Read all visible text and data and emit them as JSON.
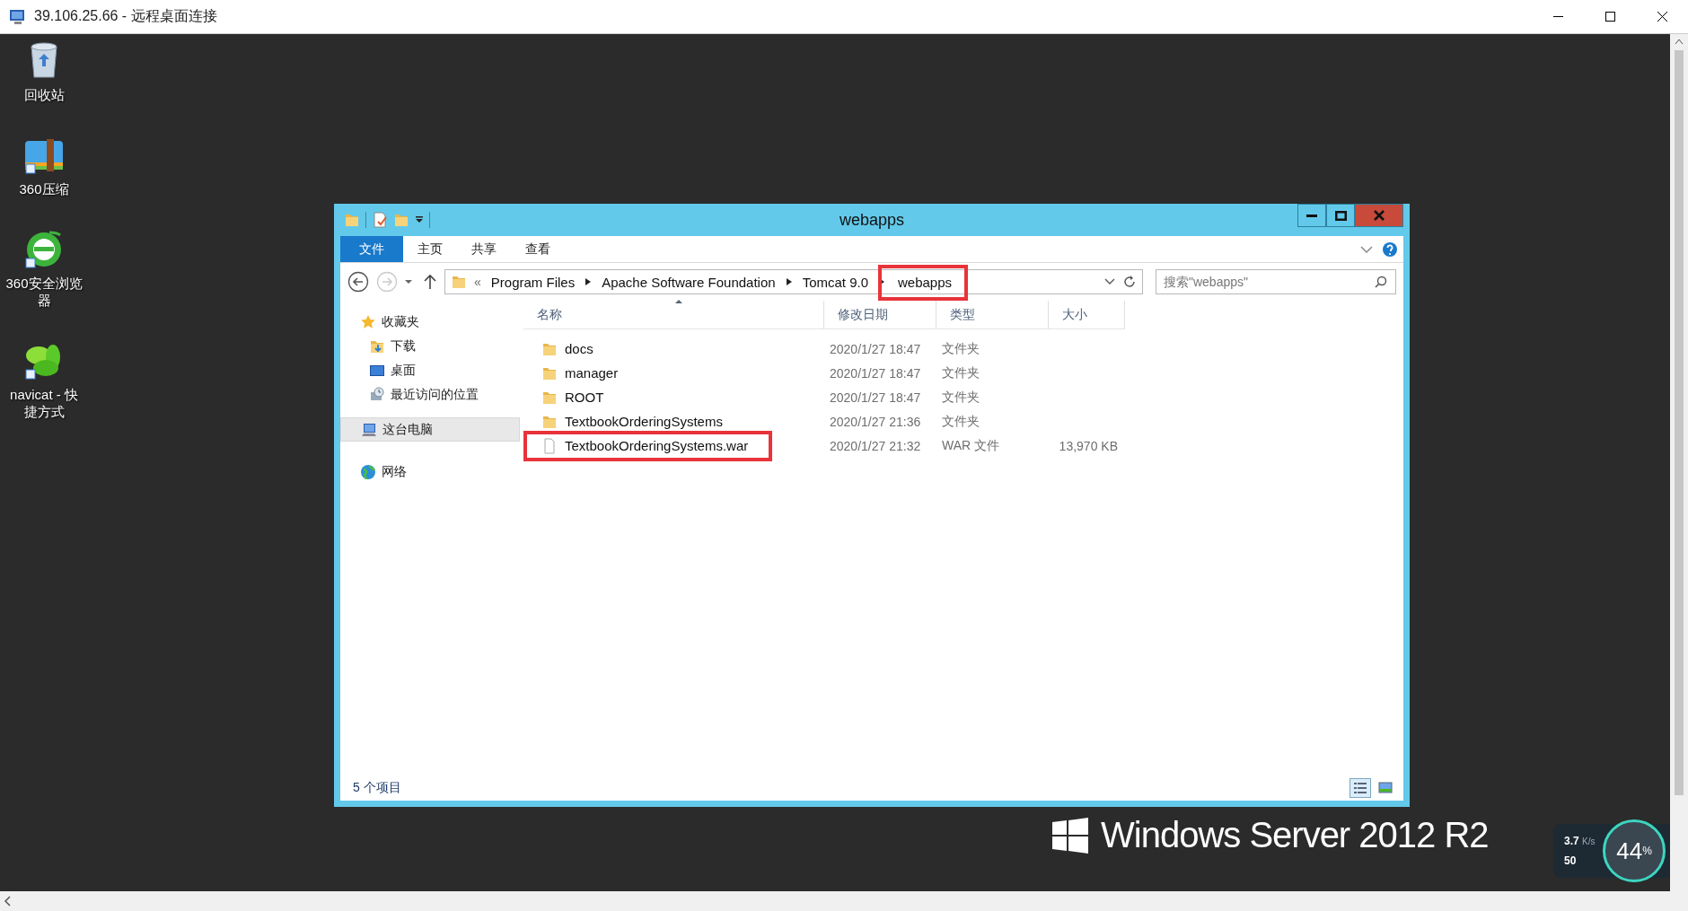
{
  "rdp_window": {
    "title": "39.106.25.66 - 远程桌面连接"
  },
  "desktop_icons": [
    {
      "label": "回收站",
      "kind": "recycle"
    },
    {
      "label": "360压缩",
      "kind": "zip"
    },
    {
      "label": "360安全浏览器",
      "kind": "browser"
    },
    {
      "label": "navicat - 快捷方式",
      "kind": "navicat"
    }
  ],
  "explorer": {
    "title": "webapps",
    "ribbon_tabs": [
      {
        "label": "文件",
        "selected": true
      },
      {
        "label": "主页",
        "selected": false
      },
      {
        "label": "共享",
        "selected": false
      },
      {
        "label": "查看",
        "selected": false
      }
    ],
    "overflow_marker": "«",
    "breadcrumb": [
      {
        "label": "Program Files",
        "highlighted": false
      },
      {
        "label": "Apache Software Foundation",
        "highlighted": false
      },
      {
        "label": "Tomcat 9.0",
        "highlighted": false
      },
      {
        "label": "webapps",
        "highlighted": true
      }
    ],
    "search": {
      "placeholder": "搜索\"webapps\""
    },
    "nav_pane": [
      {
        "label": "收藏夹",
        "kind": "favorites",
        "selected": false,
        "children": [
          {
            "label": "下载",
            "kind": "downloads",
            "selected": false
          },
          {
            "label": "桌面",
            "kind": "desktop",
            "selected": false
          },
          {
            "label": "最近访问的位置",
            "kind": "recent",
            "selected": false
          }
        ]
      },
      {
        "label": "这台电脑",
        "kind": "pc",
        "selected": true
      },
      {
        "label": "网络",
        "kind": "network",
        "selected": false
      }
    ],
    "columns": [
      {
        "label": "名称",
        "sorted": true
      },
      {
        "label": "修改日期",
        "sorted": false
      },
      {
        "label": "类型",
        "sorted": false
      },
      {
        "label": "大小",
        "sorted": false
      }
    ],
    "rows": [
      {
        "name": "docs",
        "modified": "2020/1/27 18:47",
        "type": "文件夹",
        "kind": "folder",
        "highlighted": false
      },
      {
        "name": "manager",
        "modified": "2020/1/27 18:47",
        "type": "文件夹",
        "kind": "folder",
        "highlighted": false
      },
      {
        "name": "ROOT",
        "modified": "2020/1/27 18:47",
        "type": "文件夹",
        "kind": "folder",
        "highlighted": false
      },
      {
        "name": "TextbookOrderingSystems",
        "modified": "2020/1/27 21:36",
        "type": "文件夹",
        "kind": "folder",
        "highlighted": false
      },
      {
        "name": "TextbookOrderingSystems.war",
        "modified": "2020/1/27 21:32",
        "type": "WAR 文件",
        "size": "13,970 KB",
        "kind": "file",
        "highlighted": true
      }
    ],
    "status_bar": {
      "item_count": "5 个项目"
    },
    "view_buttons": [
      {
        "kind": "details",
        "selected": true
      },
      {
        "kind": "tiles",
        "selected": false
      }
    ]
  },
  "desktop_branding": {
    "text": "Windows Server 2012 R2"
  },
  "speed_widget": {
    "upload": "3.7",
    "unit": "K/s",
    "download": "50",
    "cpu": "44",
    "percent": "%"
  }
}
